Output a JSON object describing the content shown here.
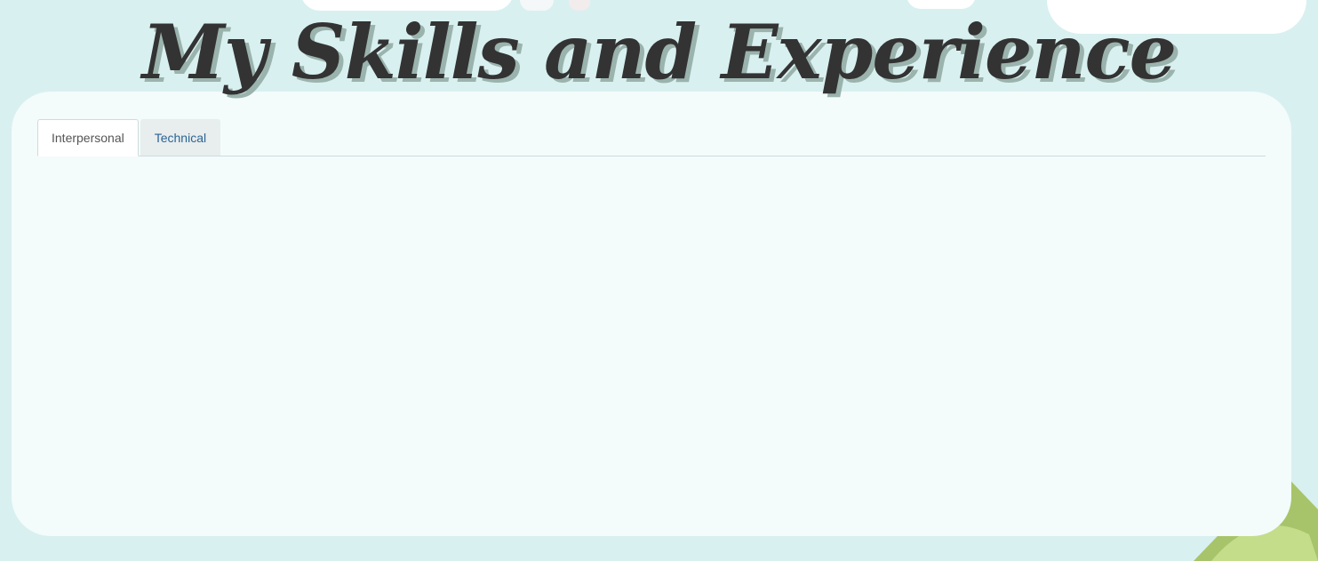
{
  "page": {
    "title": "My Skills and Experience"
  },
  "tabs": [
    {
      "label": "Interpersonal",
      "active": true
    },
    {
      "label": "Technical",
      "active": false
    }
  ],
  "colors": {
    "background": "#d9f0f0",
    "panel": "#f3fbfb",
    "title_text": "#333333",
    "title_shadow": "#9bb3ad",
    "active_tab_text": "#555555",
    "inactive_tab_text": "#2a6496"
  }
}
